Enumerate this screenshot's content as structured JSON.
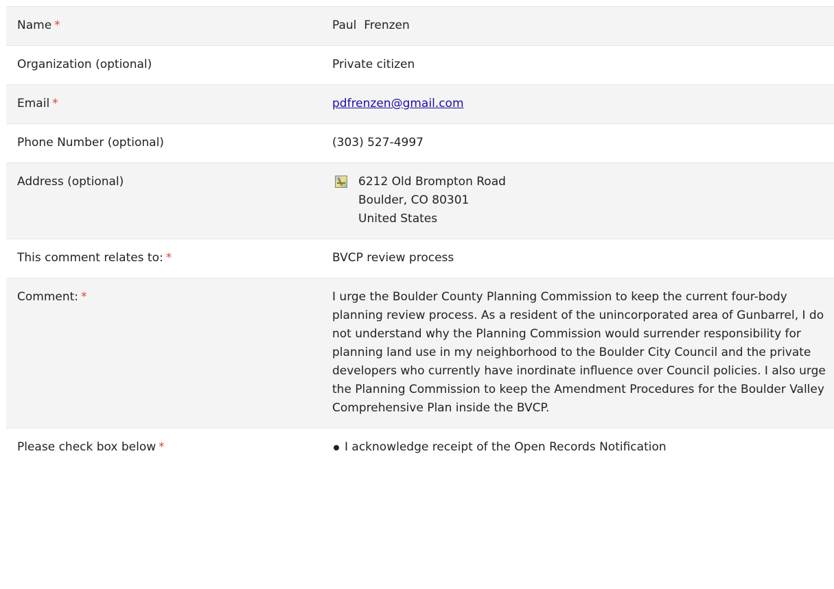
{
  "rows": {
    "name": {
      "label": "Name",
      "required": "*",
      "value": "Paul  Frenzen"
    },
    "organization": {
      "label": "Organization (optional)",
      "value": "Private citizen"
    },
    "email": {
      "label": "Email",
      "required": "*",
      "value": "pdfrenzen@gmail.com"
    },
    "phone": {
      "label": "Phone Number (optional)",
      "value": "(303) 527-4997"
    },
    "address": {
      "label": "Address (optional)",
      "icon": "map-icon",
      "line1": "6212 Old Brompton Road",
      "line2": "Boulder, CO 80301",
      "line3": "United States"
    },
    "relates": {
      "label": "This comment relates to:",
      "required": "*",
      "value": "BVCP review process"
    },
    "comment": {
      "label": "Comment:",
      "required": "*",
      "value": "I urge the Boulder County Planning Commission to keep the current four-body planning review process. As a resident of the unincorporated area of Gunbarrel, I do not understand why the Planning Commission would surrender responsibility for planning land use in my neighborhood to the Boulder City Council and the private developers who currently have inordinate influence over Council policies. I also urge the Planning Commission to keep the Amendment Procedures for the Boulder Valley Comprehensive Plan inside the BVCP."
    },
    "checkbox": {
      "label": "Please check box below",
      "required": "*",
      "value": "I acknowledge receipt of the Open Records Notification"
    }
  },
  "colors": {
    "required": "#e0403a",
    "link": "#1a0dab",
    "shaded_row": "#f4f4f4"
  }
}
